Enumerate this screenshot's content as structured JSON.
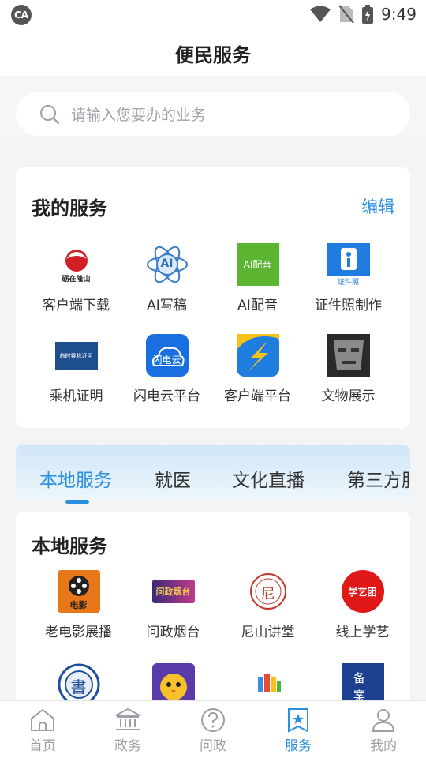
{
  "status_bar": {
    "logo_text": "CA",
    "time": "9:49"
  },
  "header": {
    "title": "便民服务"
  },
  "search": {
    "placeholder": "请输入您要办的业务"
  },
  "my_services": {
    "title": "我的服务",
    "edit_label": "编辑",
    "items": [
      {
        "label": "客户端下载",
        "icon": "app-logo-icon",
        "icon_text": "砺在隆山"
      },
      {
        "label": "AI写稿",
        "icon": "ai-atom-icon",
        "icon_text": "AI"
      },
      {
        "label": "AI配音",
        "icon": "ai-voice-icon",
        "icon_text": "AI配音"
      },
      {
        "label": "证件照制作",
        "icon": "id-photo-icon",
        "icon_text": "证件照"
      },
      {
        "label": "乘机证明",
        "icon": "boarding-certificate-icon",
        "icon_text": "临时乘机证明"
      },
      {
        "label": "闪电云平台",
        "icon": "lightning-cloud-icon",
        "icon_text": "闪电云"
      },
      {
        "label": "客户端平台",
        "icon": "lightning-bolt-icon",
        "icon_text": ""
      },
      {
        "label": "文物展示",
        "icon": "bronze-mask-icon",
        "icon_text": ""
      }
    ]
  },
  "tabs": [
    {
      "label": "本地服务",
      "active": true
    },
    {
      "label": "就医",
      "active": false
    },
    {
      "label": "文化直播",
      "active": false
    },
    {
      "label": "第三方服",
      "active": false
    }
  ],
  "local_services": {
    "title": "本地服务",
    "items": [
      {
        "label": "老电影展播",
        "icon": "film-reel-icon",
        "icon_text": "电影"
      },
      {
        "label": "问政烟台",
        "icon": "wenzheng-logo-icon",
        "icon_text": "问政烟台"
      },
      {
        "label": "尼山讲堂",
        "icon": "nishan-seal-icon",
        "icon_text": "尼"
      },
      {
        "label": "线上学艺",
        "icon": "xueyi-badge-icon",
        "icon_text": "学艺团"
      },
      {
        "label": "",
        "icon": "book-seal-icon",
        "icon_text": "書"
      },
      {
        "label": "",
        "icon": "cartoon-chick-icon",
        "icon_text": ""
      },
      {
        "label": "",
        "icon": "colorful-logo-icon",
        "icon_text": ""
      },
      {
        "label": "",
        "icon": "record-query-icon",
        "icon_text": "备案查询"
      }
    ]
  },
  "bottom_nav": [
    {
      "label": "首页",
      "icon": "home-icon",
      "active": false
    },
    {
      "label": "政务",
      "icon": "government-building-icon",
      "active": false
    },
    {
      "label": "问政",
      "icon": "question-icon",
      "active": false
    },
    {
      "label": "服务",
      "icon": "service-star-icon",
      "active": true
    },
    {
      "label": "我的",
      "icon": "user-icon",
      "active": false
    }
  ],
  "colors": {
    "accent": "#2a8fe0",
    "background": "#f3f4f6",
    "muted": "#9aa0a6"
  }
}
